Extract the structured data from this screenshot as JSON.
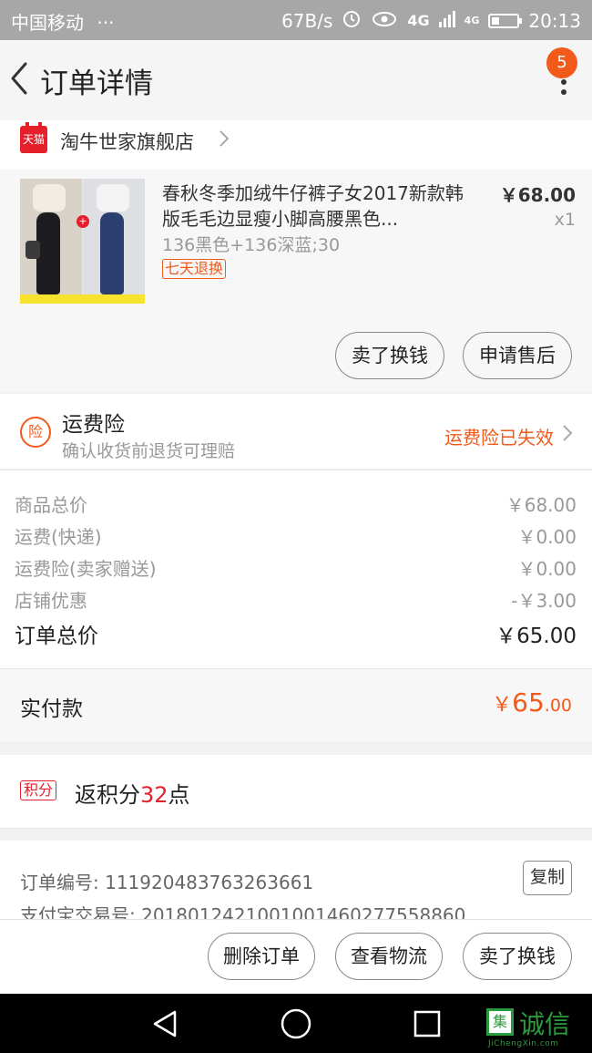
{
  "status_bar": {
    "carrier": "中国移动",
    "dots": "···",
    "speed": "67B/s",
    "network1": "4G",
    "network2": "4G",
    "time": "20:13"
  },
  "header": {
    "title": "订单详情",
    "badge_count": "5"
  },
  "shop": {
    "badge": "天猫",
    "name": "淘牛世家旗舰店"
  },
  "product": {
    "name": "春秋冬季加绒牛仔裤子女2017新款韩版毛毛边显瘦小脚高腰黑色...",
    "price": "￥68.00",
    "quantity": "x1",
    "sku": "136黑色+136深蓝;30",
    "return_tag": "七天退换",
    "actions": [
      "卖了换钱",
      "申请售后"
    ]
  },
  "insurance": {
    "icon_label": "险",
    "title": "运费险",
    "subtitle": "确认收货前退货可理赔",
    "status": "运费险已失效"
  },
  "fees": [
    {
      "label": "商品总价",
      "value": "￥68.00"
    },
    {
      "label": "运费(快递)",
      "value": "￥0.00"
    },
    {
      "label": "运费险(卖家赠送)",
      "value": "￥0.00"
    },
    {
      "label": "店铺优惠",
      "value": "-￥3.00"
    }
  ],
  "order_total": {
    "label": "订单总价",
    "value": "￥65.00"
  },
  "paid": {
    "label": "实付款",
    "symbol": "￥",
    "integer": "65",
    "decimal": ".00"
  },
  "points": {
    "badge": "积分",
    "prefix": "返积分",
    "number": "32",
    "suffix": "点"
  },
  "order_info": {
    "order_number": "订单编号: 111920483763263661",
    "copy_label": "复制",
    "alipay": "支付宝交易号: 2018012421001001460277558860"
  },
  "bottom_actions": [
    "删除订单",
    "查看物流",
    "卖了换钱"
  ],
  "watermark": {
    "text": "诚信",
    "box": "集",
    "sub": "JiChengXin.com"
  },
  "colors": {
    "accent": "#f25a1c",
    "tmall_red": "#e5202b",
    "watermark_green": "#2c9b3f"
  }
}
